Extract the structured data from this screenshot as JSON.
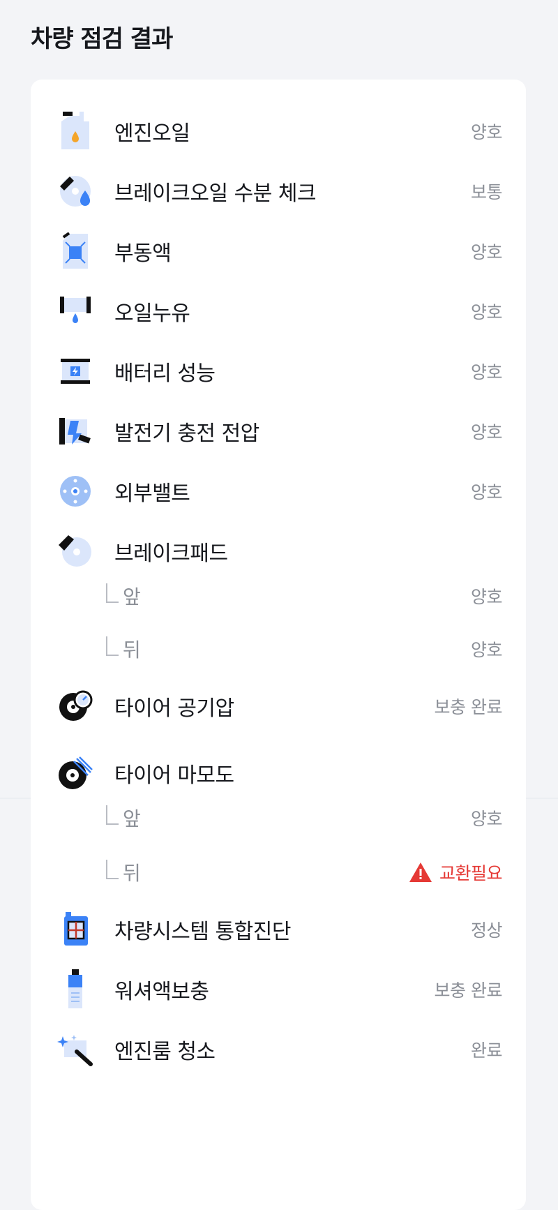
{
  "page": {
    "title": "차량 점검 결과"
  },
  "items": [
    {
      "label": "엔진오일",
      "status": "양호",
      "icon": "engine-oil-icon"
    },
    {
      "label": "브레이크오일 수분 체크",
      "status": "보통",
      "icon": "brake-oil-icon"
    },
    {
      "label": "부동액",
      "status": "양호",
      "icon": "coolant-icon"
    },
    {
      "label": "오일누유",
      "status": "양호",
      "icon": "oil-leak-icon"
    },
    {
      "label": "배터리 성능",
      "status": "양호",
      "icon": "battery-icon"
    },
    {
      "label": "발전기 충전 전압",
      "status": "양호",
      "icon": "alternator-icon"
    },
    {
      "label": "외부밸트",
      "status": "양호",
      "icon": "belt-icon"
    },
    {
      "label": "브레이크패드",
      "status": "",
      "icon": "brake-pad-icon",
      "sub": [
        {
          "label": "앞",
          "status": "양호"
        },
        {
          "label": "뒤",
          "status": "양호"
        }
      ]
    },
    {
      "label": "타이어 공기압",
      "status": "보충 완료",
      "icon": "tire-pressure-icon"
    },
    {
      "label": "타이어 마모도",
      "status": "",
      "icon": "tire-wear-icon",
      "sub": [
        {
          "label": "앞",
          "status": "양호"
        },
        {
          "label": "뒤",
          "status": "교환필요",
          "warning": true
        }
      ]
    },
    {
      "label": "차량시스템 통합진단",
      "status": "정상",
      "icon": "diagnostic-scanner-icon"
    },
    {
      "label": "워셔액보충",
      "status": "보충 완료",
      "icon": "washer-fluid-icon"
    },
    {
      "label": "엔진룸 청소",
      "status": "완료",
      "icon": "engine-room-cleaning-icon"
    }
  ],
  "colors": {
    "accent": "#3b82f6",
    "warning": "#e53935",
    "muted": "#8b8f97",
    "background": "#f3f4f7"
  }
}
